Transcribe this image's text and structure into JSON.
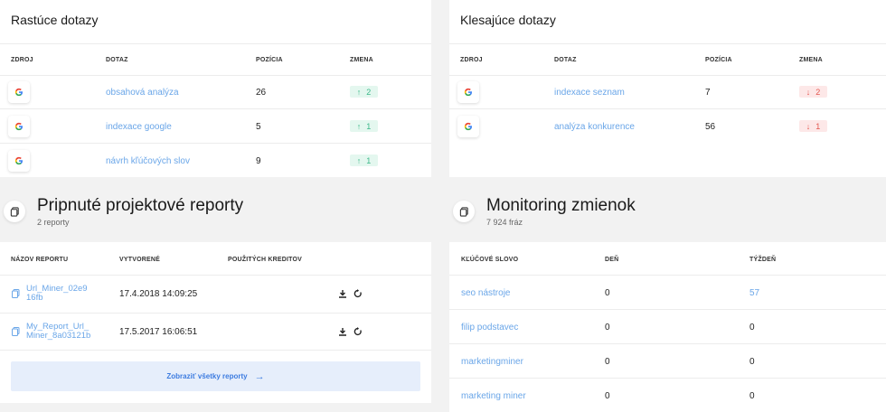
{
  "rising": {
    "title": "Rastúce dotazy",
    "headers": {
      "source": "ZDROJ",
      "query": "DOTAZ",
      "position": "POZÍCIA",
      "change": "ZMENA"
    },
    "rows": [
      {
        "source_icon": "google-icon",
        "query": "obsahová analýza",
        "position": "26",
        "change_arrow": "↑",
        "change": "2"
      },
      {
        "source_icon": "google-icon",
        "query": "indexace google",
        "position": "5",
        "change_arrow": "↑",
        "change": "1"
      },
      {
        "source_icon": "google-icon",
        "query": "návrh kľúčových slov",
        "position": "9",
        "change_arrow": "↑",
        "change": "1"
      }
    ]
  },
  "falling": {
    "title": "Klesajúce dotazy",
    "headers": {
      "source": "ZDROJ",
      "query": "DOTAZ",
      "position": "POZÍCIA",
      "change": "ZMENA"
    },
    "rows": [
      {
        "source_icon": "google-icon",
        "query": "indexace seznam",
        "position": "7",
        "change_arrow": "↓",
        "change": "2"
      },
      {
        "source_icon": "google-icon",
        "query": "analýza konkurence",
        "position": "56",
        "change_arrow": "↓",
        "change": "1"
      }
    ]
  },
  "reports": {
    "title": "Pripnuté projektové reporty",
    "subtitle": "2 reporty",
    "icon": "documents-icon",
    "headers": {
      "name": "NÁZOV REPORTU",
      "created": "VYTVORENÉ",
      "credits": "POUŽITÝCH KREDITOV"
    },
    "rows": [
      {
        "name_line1": "Url_Miner_02e9",
        "name_line2": "16fb",
        "created": "17.4.2018 14:09:25",
        "credits": ""
      },
      {
        "name_line1": "My_Report_Url_",
        "name_line2": "Miner_8a03121b",
        "created": "17.5.2017 16:06:51",
        "credits": ""
      }
    ],
    "show_all_label": "Zobraziť všetky reporty",
    "show_all_arrow": "→"
  },
  "mentions": {
    "title": "Monitoring zmienok",
    "subtitle": "7 924 fráz",
    "icon": "documents-icon",
    "headers": {
      "keyword": "KĽÚČOVÉ SLOVO",
      "day": "DEŇ",
      "week": "TÝŽDEŇ"
    },
    "rows": [
      {
        "keyword": "seo nástroje",
        "day": "0",
        "week": "57"
      },
      {
        "keyword": "filip podstavec",
        "day": "0",
        "week": "0"
      },
      {
        "keyword": "marketingminer",
        "day": "0",
        "week": "0"
      },
      {
        "keyword": "marketing miner",
        "day": "0",
        "week": "0"
      }
    ]
  },
  "colors": {
    "link": "#6aa6e8",
    "up": "#3cb98a",
    "down": "#e4574f",
    "accent": "#3d7ce0"
  }
}
